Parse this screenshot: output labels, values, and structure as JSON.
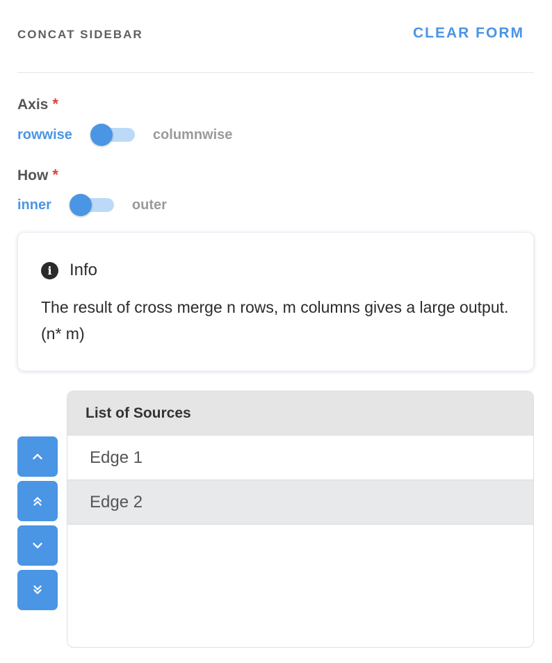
{
  "header": {
    "title": "CONCAT SIDEBAR",
    "clear_label": "CLEAR FORM"
  },
  "axis": {
    "label": "Axis",
    "required_mark": "*",
    "left_option": "rowwise",
    "right_option": "columnwise",
    "selected": "rowwise"
  },
  "how": {
    "label": "How",
    "required_mark": "*",
    "left_option": "inner",
    "right_option": "outer",
    "selected": "inner"
  },
  "info": {
    "icon_glyph": "i",
    "title": "Info",
    "text": "The result of cross merge n rows, m columns gives a large output. (n* m)"
  },
  "order_buttons": {
    "icons": [
      "chevron-up-icon",
      "double-chevron-up-icon",
      "chevron-down-icon",
      "double-chevron-down-icon"
    ]
  },
  "sources": {
    "title": "List of Sources",
    "items": [
      "Edge 1",
      "Edge 2"
    ]
  },
  "colors": {
    "accent": "#4a95e4",
    "track": "#bcdaf8",
    "required": "#e0403f",
    "header_bg": "#e5e5e5"
  }
}
